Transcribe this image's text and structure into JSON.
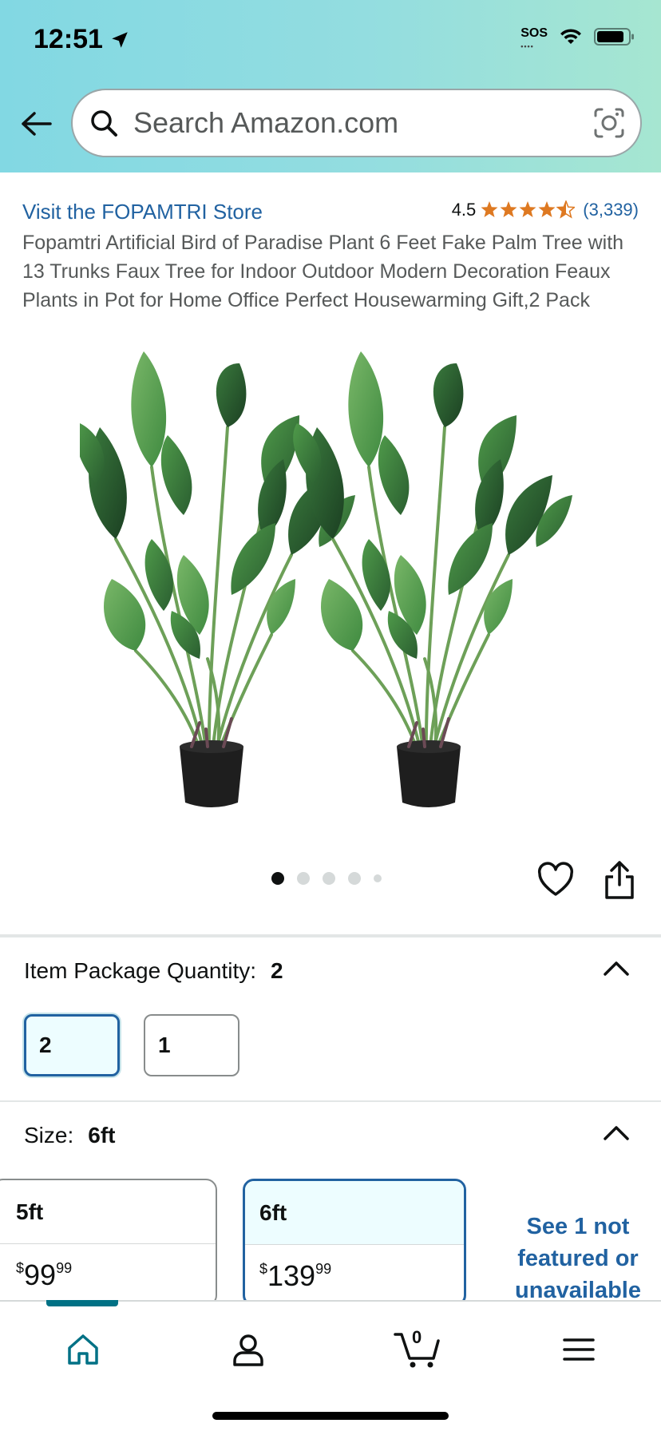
{
  "status_bar": {
    "time": "12:51",
    "sos": "SOS"
  },
  "search": {
    "placeholder": "Search Amazon.com"
  },
  "product": {
    "store_link": "Visit the FOPAMTRI Store",
    "rating_value": "4.5",
    "rating_stars": 4.5,
    "rating_count": "(3,339)",
    "title": "Fopamtri Artificial Bird of Paradise Plant 6 Feet Fake Palm Tree with 13 Trunks Faux Tree for Indoor Outdoor Modern Decoration Feaux Plants in Pot for Home Office Perfect Housewarming Gift,2 Pack",
    "image_alt": "Two artificial bird of paradise plants in black pots",
    "image_count": 5,
    "image_index": 1
  },
  "quantity": {
    "label": "Item Package Quantity:",
    "selected": "2",
    "options": [
      "2",
      "1"
    ]
  },
  "size": {
    "label": "Size:",
    "selected": "6ft",
    "options": [
      {
        "name": "5ft",
        "price_whole": "99",
        "price_fraction": "99",
        "currency": "$"
      },
      {
        "name": "6ft",
        "price_whole": "139",
        "price_fraction": "99",
        "currency": "$"
      }
    ],
    "see_more": "See 1 not featured or unavailable"
  },
  "bottom_nav": {
    "items": [
      "home",
      "account",
      "cart",
      "menu"
    ],
    "cart_count": "0",
    "active": "home"
  },
  "colors": {
    "link": "#2162a1",
    "star": "#de7921",
    "accent_teal": "#007185",
    "selected_bg": "#edfdff"
  }
}
